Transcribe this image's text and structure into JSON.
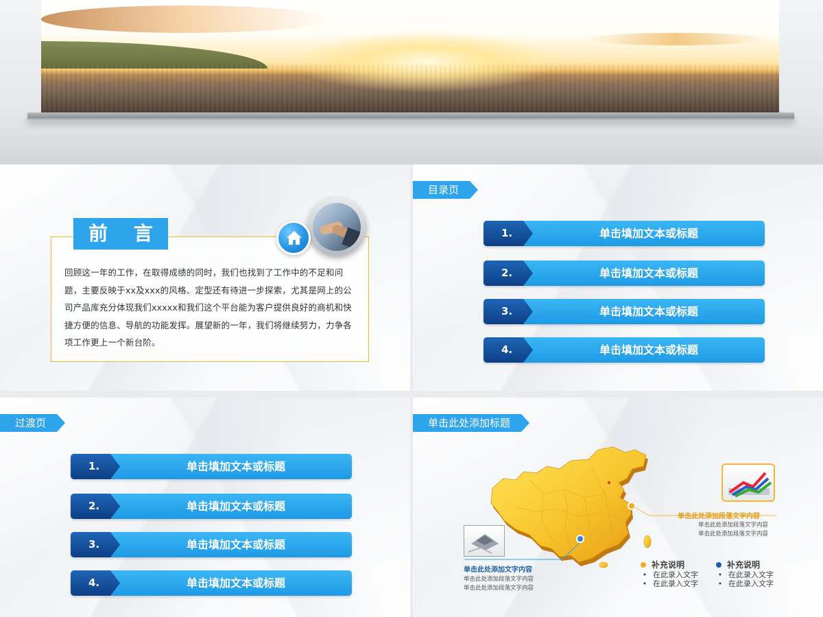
{
  "preface": {
    "title": "前 言",
    "body": "回顾这一年的工作，在取得成绩的同时，我们也找到了工作中的不足和问题，主要反映于xx及xxx的风格、定型还有待进一步探索，尤其是网上的公司产品库充分体现我们xxxxx和我们这个平台能为客户提供良好的商机和快捷方便的信息、导航的功能发挥。展望新的一年，我们将继续努力，力争各项工作更上一个新台阶。"
  },
  "toc": {
    "tag": "目录页",
    "items": [
      {
        "num": "1.",
        "label": "单击填加文本或标题"
      },
      {
        "num": "2.",
        "label": "单击填加文本或标题"
      },
      {
        "num": "3.",
        "label": "单击填加文本或标题"
      },
      {
        "num": "4.",
        "label": "单击填加文本或标题"
      }
    ]
  },
  "transition": {
    "tag": "过渡页",
    "items": [
      {
        "num": "1.",
        "label": "单击填加文本或标题"
      },
      {
        "num": "2.",
        "label": "单击填加文本或标题"
      },
      {
        "num": "3.",
        "label": "单击填加文本或标题"
      },
      {
        "num": "4.",
        "label": "单击填加文本或标题"
      }
    ]
  },
  "map_slide": {
    "tag": "单击此处添加标题",
    "callout_right": {
      "title": "单击此处添加段落文字内容",
      "line1": "单击此处添加段落文字内容",
      "line2": "单击此处添加段落文字内容"
    },
    "callout_left": {
      "title": "单击此处添加文字内容",
      "line1": "单击此处添加段落文字内容",
      "line2": "单击此处添加段落文字内容"
    },
    "legend": [
      {
        "title": "补充说明",
        "color": "#f2a91d",
        "items": [
          "在此录入文字",
          "在此录入文字"
        ]
      },
      {
        "title": "补充说明",
        "color": "#1f5fa8",
        "items": [
          "在此录入文字",
          "在此录入文字"
        ]
      }
    ]
  },
  "colors": {
    "accent_blue": "#2ea4ec",
    "dark_blue": "#0d3f86",
    "gold": "#f2b635",
    "title_orange": "#e89a10",
    "title_blue": "#1f5fa8"
  }
}
